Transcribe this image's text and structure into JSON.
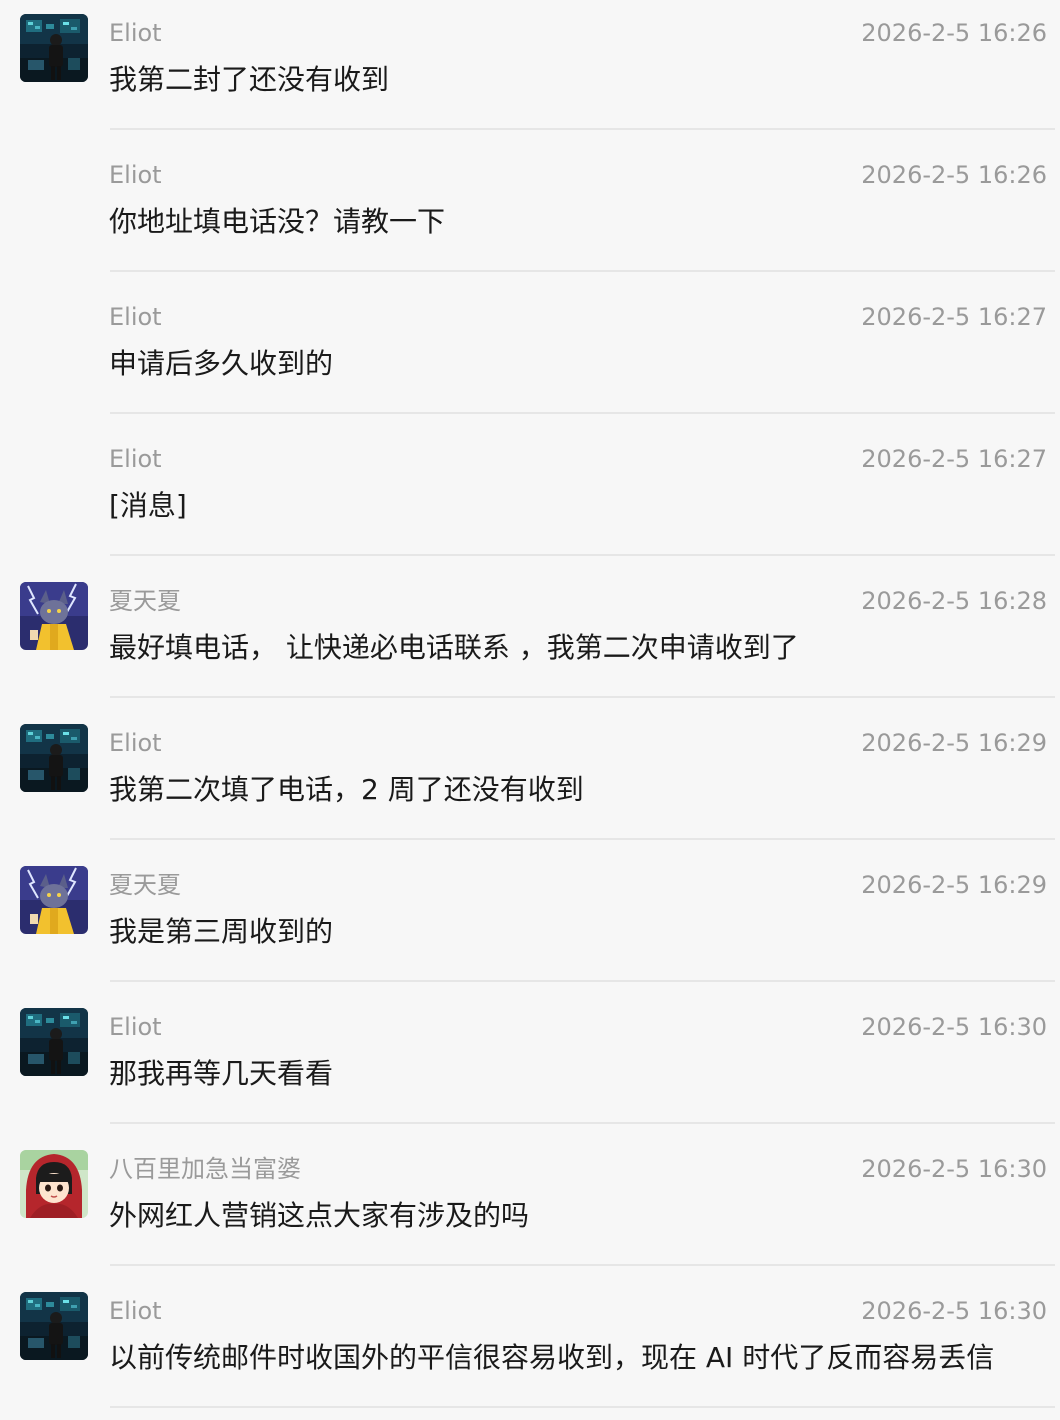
{
  "messages": [
    {
      "sender": "Eliot",
      "time": "2026-2-5 16:26",
      "text": "我第二封了还没有收到",
      "avatar": "eliot-avatar",
      "show_avatar": true
    },
    {
      "sender": "Eliot",
      "time": "2026-2-5 16:26",
      "text": "你地址填电话没？请教一下",
      "avatar": "eliot-avatar",
      "show_avatar": false
    },
    {
      "sender": "Eliot",
      "time": "2026-2-5 16:27",
      "text": "申请后多久收到的",
      "avatar": "eliot-avatar",
      "show_avatar": false
    },
    {
      "sender": "Eliot",
      "time": "2026-2-5 16:27",
      "text": "[消息]",
      "avatar": "eliot-avatar",
      "show_avatar": false
    },
    {
      "sender": "夏天夏",
      "time": "2026-2-5 16:28",
      "text": "最好填电话， 让快递必电话联系 ，我第二次申请收到了",
      "avatar": "xiatianxia-avatar",
      "show_avatar": true
    },
    {
      "sender": "Eliot",
      "time": "2026-2-5 16:29",
      "text": "我第二次填了电话，2 周了还没有收到",
      "avatar": "eliot-avatar",
      "show_avatar": true
    },
    {
      "sender": "夏天夏",
      "time": "2026-2-5 16:29",
      "text": "我是第三周收到的",
      "avatar": "xiatianxia-avatar",
      "show_avatar": true
    },
    {
      "sender": "Eliot",
      "time": "2026-2-5 16:30",
      "text": "那我再等几天看看",
      "avatar": "eliot-avatar",
      "show_avatar": true
    },
    {
      "sender": "八百里加急当富婆",
      "time": "2026-2-5 16:30",
      "text": "外网红人营销这点大家有涉及的吗",
      "avatar": "babaili-avatar",
      "show_avatar": true
    },
    {
      "sender": "Eliot",
      "time": "2026-2-5 16:30",
      "text": "以前传统邮件时收国外的平信很容易收到，现在 AI 时代了反而容易丢信",
      "avatar": "eliot-avatar",
      "show_avatar": true
    }
  ],
  "colors": {
    "background": "#f7f7f7",
    "meta_text": "#9a9a9a",
    "message_text": "#1a1a1a",
    "divider": "#e6e6e6"
  }
}
